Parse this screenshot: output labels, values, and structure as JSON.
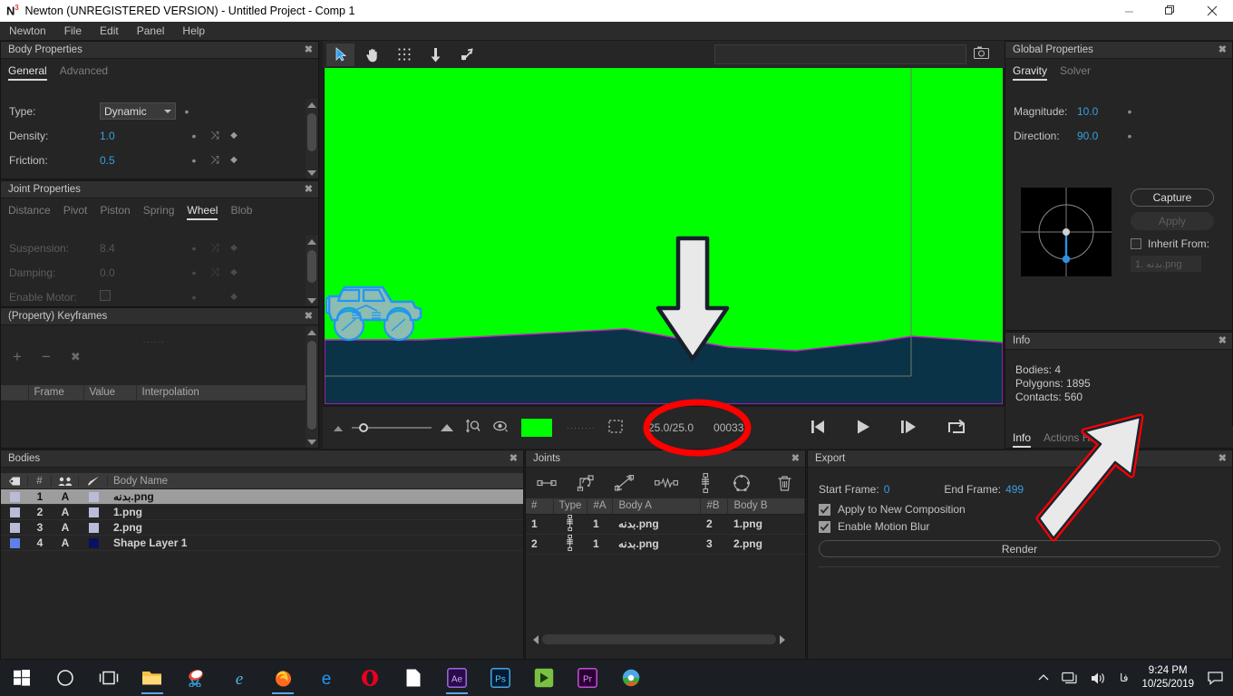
{
  "titlebar": {
    "logo": "N",
    "logo_sup": "3",
    "title": "Newton (UNREGISTERED VERSION) - Untitled Project - Comp 1",
    "minimize": "—",
    "maximize": "❐",
    "close": "✕"
  },
  "menubar": {
    "items": [
      "Newton",
      "File",
      "Edit",
      "Panel",
      "Help"
    ]
  },
  "body_properties": {
    "title": "Body Properties",
    "close": "✖",
    "tabs": [
      {
        "label": "General",
        "active": true
      },
      {
        "label": "Advanced",
        "active": false
      }
    ],
    "rows": [
      {
        "label": "Type:",
        "value": "Dynamic",
        "kind": "combo",
        "dot": "•",
        "shuffle": "",
        "diamond": ""
      },
      {
        "label": "Density:",
        "value": "1.0",
        "kind": "text",
        "dot": "•",
        "shuffle": "⤨",
        "diamond": "◆"
      },
      {
        "label": "Friction:",
        "value": "0.5",
        "kind": "text",
        "dot": "•",
        "shuffle": "⤨",
        "diamond": "◆"
      }
    ]
  },
  "joint_properties": {
    "title": "Joint Properties",
    "close": "✖",
    "tabs": [
      {
        "label": "Distance",
        "active": false
      },
      {
        "label": "Pivot",
        "active": false
      },
      {
        "label": "Piston",
        "active": false
      },
      {
        "label": "Spring",
        "active": false
      },
      {
        "label": "Wheel",
        "active": true
      },
      {
        "label": "Blob",
        "active": false
      }
    ],
    "rows": [
      {
        "label": "Suspension:",
        "value": "8.4",
        "kind": "text",
        "dot": "•",
        "shuffle": "⤨",
        "diamond": "◆"
      },
      {
        "label": "Damping:",
        "value": "0.0",
        "kind": "text",
        "dot": "•",
        "shuffle": "⤨",
        "diamond": "◆"
      },
      {
        "label": "Enable Motor:",
        "value": "",
        "kind": "checkbox",
        "dot": "•",
        "shuffle": "",
        "diamond": "◆"
      }
    ]
  },
  "keyframes": {
    "title": "(Property) Keyframes",
    "close": "✖",
    "grip": "······",
    "toolbar": {
      "add": "+",
      "remove": "−",
      "clear": "✖"
    },
    "columns": [
      "",
      "Frame",
      "Value",
      "Interpolation"
    ],
    "rows": []
  },
  "bodies": {
    "title": "Bodies",
    "close": "✖",
    "columns": [
      "tag-icon",
      "#",
      "group-icon",
      "brush-icon",
      "Body Name"
    ],
    "column_labels": {
      "number": "#",
      "name": "Body Name"
    },
    "rows": [
      {
        "num": "1",
        "group": "A",
        "name": "بدنه.png",
        "swatch": "#b9bcd8",
        "chip": "#b9bcd8",
        "selected": true
      },
      {
        "num": "2",
        "group": "A",
        "name": "1.png",
        "swatch": "#b9bcd8",
        "chip": "#b9bcd8",
        "selected": false
      },
      {
        "num": "3",
        "group": "A",
        "name": "2.png",
        "swatch": "#b9bcd8",
        "chip": "#b9bcd8",
        "selected": false
      },
      {
        "num": "4",
        "group": "A",
        "name": "Shape Layer 1",
        "swatch": "#5f80e8",
        "chip": "#0b1060",
        "selected": false
      }
    ]
  },
  "joints": {
    "title": "Joints",
    "close": "✖",
    "toolbar_icons": [
      "distance-joint-icon",
      "pivot-joint-icon",
      "piston-joint-icon",
      "spring-joint-icon",
      "wheel-joint-icon",
      "blob-joint-icon",
      "trash-icon"
    ],
    "columns": [
      "#",
      "Type",
      "#A",
      "Body A",
      "#B",
      "Body B"
    ],
    "rows": [
      {
        "num": "1",
        "type": "wheel-joint-icon",
        "a_num": "1",
        "a_name": "بدنه.png",
        "b_num": "2",
        "b_name": "1.png"
      },
      {
        "num": "2",
        "type": "wheel-joint-icon",
        "a_num": "1",
        "a_name": "بدنه.png",
        "b_num": "3",
        "b_name": "2.png"
      }
    ]
  },
  "export": {
    "title": "Export",
    "close": "✖",
    "start_frame_label": "Start Frame:",
    "start_frame_value": "0",
    "end_frame_label": "End Frame:",
    "end_frame_value": "499",
    "checkboxes": [
      {
        "label": "Apply to New Composition",
        "checked": true
      },
      {
        "label": "Enable Motion Blur",
        "checked": true
      }
    ],
    "render_button": "Render"
  },
  "global_properties": {
    "title": "Global Properties",
    "close": "✖",
    "tabs": [
      {
        "label": "Gravity",
        "active": true
      },
      {
        "label": "Solver",
        "active": false
      }
    ],
    "magnitude_label": "Magnitude:",
    "magnitude_value": "10.0",
    "direction_label": "Direction:",
    "direction_value": "90.0",
    "dot": "•",
    "capture_button": "Capture",
    "apply_button": "Apply",
    "inherit_label": "Inherit From:",
    "inherit_checked": false,
    "inherit_value": "1. بدنه.png"
  },
  "info": {
    "title": "Info",
    "close": "✖",
    "lines": [
      "Bodies: 4",
      "Polygons: 1895",
      "Contacts: 560"
    ],
    "tabs": [
      {
        "label": "Info",
        "active": true
      },
      {
        "label": "Actions History",
        "active": false
      }
    ]
  },
  "viewport": {
    "tools": [
      "select-arrow-icon",
      "hand-pan-icon",
      "grid-icon",
      "down-arrow-icon",
      "diagonal-arrow-icon"
    ],
    "selected_tool": "select-arrow-icon",
    "search_value": "",
    "camera_icon": "camera-icon",
    "stage_bg_color": "#00ff00",
    "terrain_color": "#0b3347",
    "terrain_outline": "#d01ad0",
    "car_body_color": "#8dbdb0",
    "car_outline_color": "#2196f3"
  },
  "timebar": {
    "zoom_out_icon": "small-triangle-icon",
    "zoom_in_icon": "large-triangle-icon",
    "fit_icon": "fit-zoom-icon",
    "eye_icon": "eye-icon",
    "color_swatch": "#00ff00",
    "dots_icon": "dots-icon",
    "marquee_icon": "marquee-icon",
    "fps_readout": "25.0/25.0",
    "frame_readout": "00033",
    "transport": [
      "skip-to-start-icon",
      "play-icon",
      "step-forward-icon",
      "loop-icon"
    ]
  },
  "annotations": {
    "down_arrow": {
      "label": "red-outlined-down-arrow"
    },
    "red_ellipse": {
      "label": "red-ellipse-highlight"
    },
    "diagonal_arrow": {
      "label": "red-outlined-diagonal-arrow"
    }
  },
  "taskbar": {
    "items": [
      "windows-start-icon",
      "cortana-circle-icon",
      "task-view-icon",
      "file-explorer-icon",
      "snipping-tool-icon",
      "internet-explorer-icon",
      "firefox-icon",
      "edge-icon",
      "opera-icon",
      "notepad-icon",
      "after-effects-icon",
      "photoshop-icon",
      "media-encoder-icon",
      "premiere-pro-icon",
      "idm-icon"
    ],
    "tray": {
      "chevron_up": "show-hidden-icons",
      "network": "network-icon",
      "volume": "volume-icon",
      "language": "فا",
      "time": "9:24 PM",
      "date": "10/25/2019",
      "action_center": "action-center-icon"
    }
  }
}
